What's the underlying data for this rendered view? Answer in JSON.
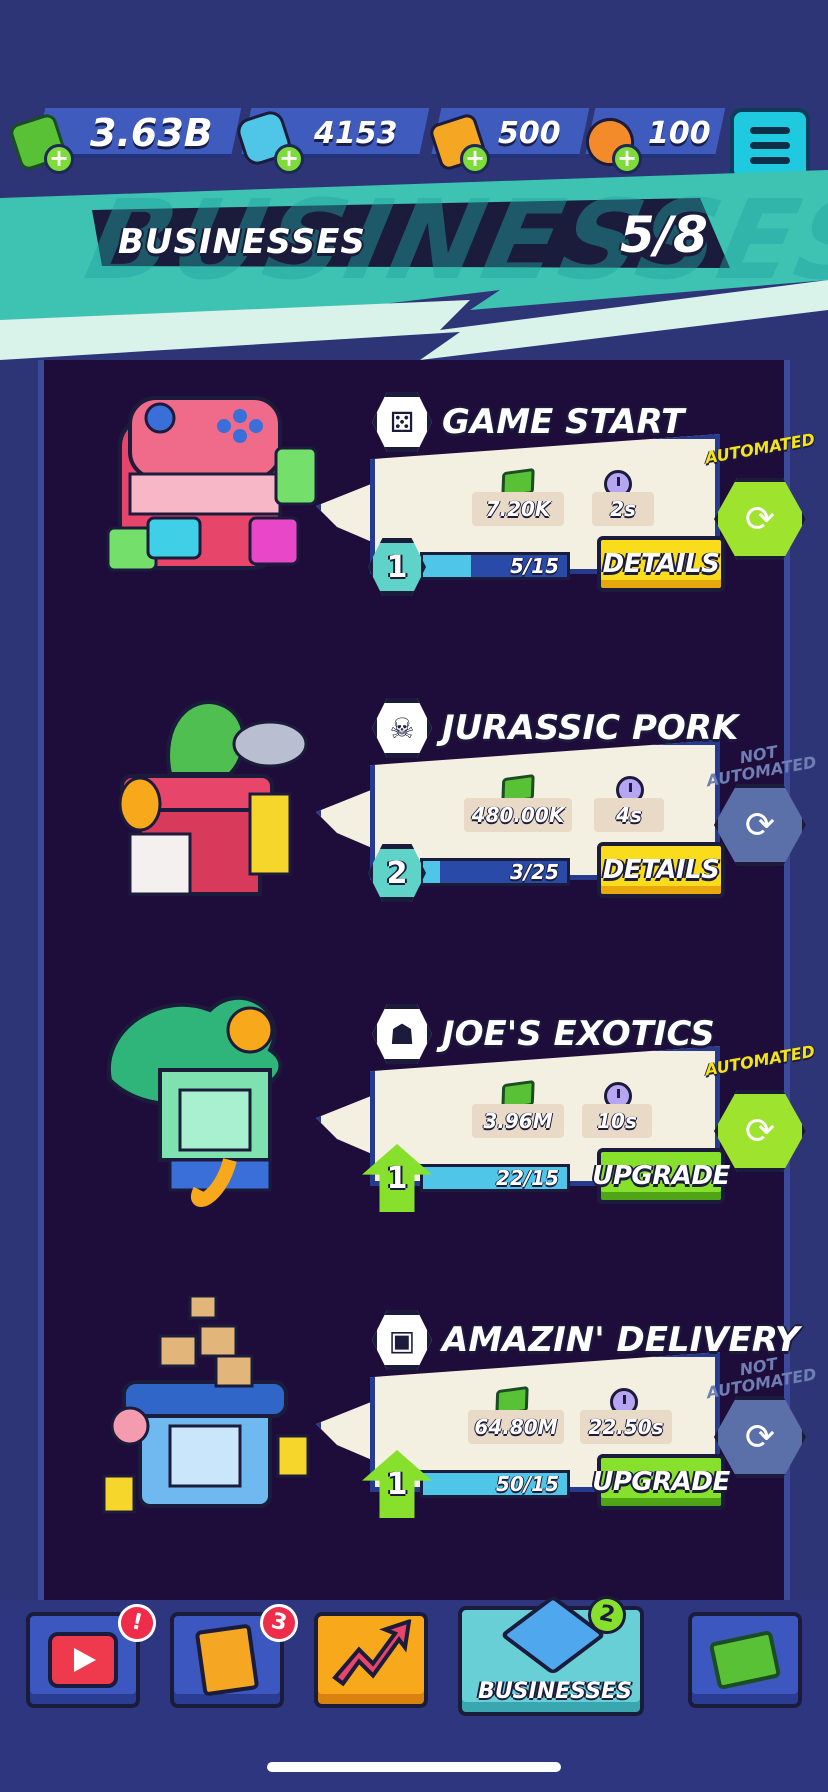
{
  "currencies": [
    {
      "name": "cash",
      "value": "3.63B",
      "color": "#59c136"
    },
    {
      "name": "energy",
      "value": "4153",
      "color": "#4fc6e8"
    },
    {
      "name": "gold",
      "value": "500",
      "color": "#f5a623"
    },
    {
      "name": "coins",
      "value": "100",
      "color": "#f38b2b"
    }
  ],
  "header": {
    "background_text": "BUSINESSES",
    "title": "BUSINESSES",
    "count": "5/8"
  },
  "businesses": [
    {
      "name": "GAME START",
      "icon": "gamepad-icon",
      "income": "7.20K",
      "time": "2s",
      "level": "1",
      "level_type": "hex",
      "progress": "5/15",
      "progress_fraction": 0.33,
      "button": "DETAILS",
      "button_style": "yellow",
      "automated": true,
      "automation_label": "AUTOMATED"
    },
    {
      "name": "JURASSIC PORK",
      "icon": "dinosaur-icon",
      "income": "480.00K",
      "time": "4s",
      "level": "2",
      "level_type": "hex",
      "progress": "3/25",
      "progress_fraction": 0.12,
      "button": "DETAILS",
      "button_style": "yellow",
      "automated": false,
      "automation_label": "NOT AUTOMATED"
    },
    {
      "name": "JOE'S EXOTICS",
      "icon": "tiger-icon",
      "income": "3.96M",
      "time": "10s",
      "level": "1",
      "level_type": "upgrade",
      "progress": "22/15",
      "progress_fraction": 1.0,
      "button": "UPGRADE",
      "button_style": "green",
      "automated": true,
      "automation_label": "AUTOMATED"
    },
    {
      "name": "AMAZIN' DELIVERY",
      "icon": "box-icon",
      "income": "64.80M",
      "time": "22.50s",
      "level": "1",
      "level_type": "upgrade",
      "progress": "50/15",
      "progress_fraction": 1.0,
      "button": "UPGRADE",
      "button_style": "green",
      "automated": false,
      "automation_label": "NOT AUTOMATED"
    }
  ],
  "nav": {
    "tabs": [
      {
        "name": "video-tab",
        "icon": "play-video-icon",
        "badge": "!"
      },
      {
        "name": "cards-tab",
        "icon": "cards-icon",
        "badge": "3"
      },
      {
        "name": "boost-tab",
        "icon": "trending-arrow-icon",
        "badge": ""
      },
      {
        "name": "businesses-tab",
        "icon": "building-icon",
        "badge": "2",
        "label": "BUSINESSES",
        "active": true
      },
      {
        "name": "shop-tab",
        "icon": "cash-coins-icon",
        "badge": ""
      }
    ]
  }
}
